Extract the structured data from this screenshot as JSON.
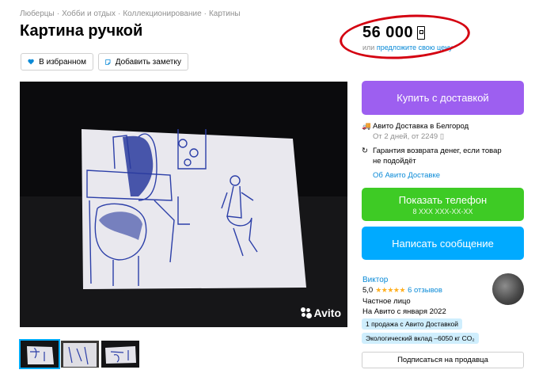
{
  "breadcrumbs": [
    "Люберцы",
    "Хобби и отдых",
    "Коллекционирование",
    "Картины"
  ],
  "title": "Картина ручкой",
  "actions": {
    "favorite_label": "В избранном",
    "note_label": "Добавить заметку"
  },
  "price": {
    "value": "56 000",
    "sub_prefix": "или",
    "sub_link": "предложите свою цену"
  },
  "photo": {
    "watermark": "Avito"
  },
  "buy_button": "Купить с доставкой",
  "delivery": {
    "title": "Авито Доставка в Белгород",
    "terms": "От 2 дней, от 2249",
    "guarantee_line1": "Гарантия возврата денег, если товар",
    "guarantee_line2": "не подойдёт",
    "about_link": "Об Авито Доставке"
  },
  "phone_button": {
    "label": "Показать телефон",
    "masked": "8 XXX XXX-XX-XX"
  },
  "message_button": "Написать сообщение",
  "seller": {
    "name": "Виктор",
    "rating": "5,0",
    "stars": "★★★★★",
    "reviews": "6 отзывов",
    "type": "Частное лицо",
    "since": "На Авито с января 2022",
    "badge_sales": "1 продажа с Авито Доставкой",
    "badge_eco": "Экологический вклад –6050 кг CO₂",
    "subscribe": "Подписаться на продавца"
  },
  "colors": {
    "buy": "#9d5ff0",
    "phone": "#3ecb25",
    "message": "#00aaff",
    "link": "#0a8ad7",
    "highlight_circle": "#d40010"
  }
}
